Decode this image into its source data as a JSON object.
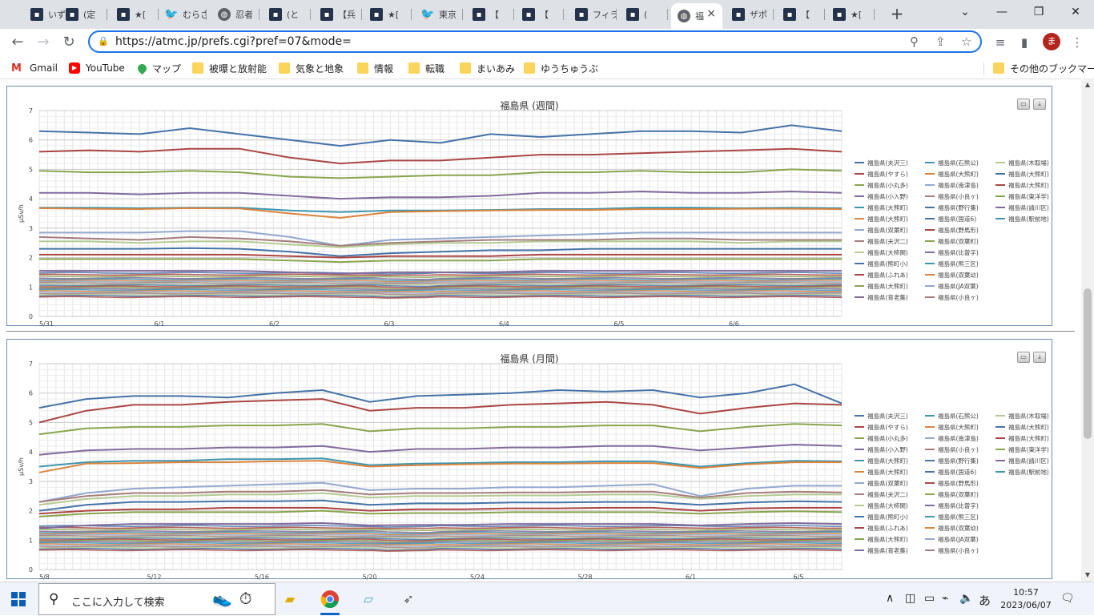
{
  "browser": {
    "tabs": [
      {
        "title": "いず",
        "icon": "site-favicon",
        "kind": "site"
      },
      {
        "title": "(定",
        "icon": "site-favicon",
        "kind": "site"
      },
      {
        "title": "★[",
        "icon": "site-favicon",
        "kind": "site"
      },
      {
        "title": "むらさ",
        "icon": "twitter-icon",
        "kind": "tw"
      },
      {
        "title": "忍者",
        "icon": "globe-icon",
        "kind": "globe"
      },
      {
        "title": "(と",
        "icon": "site-favicon",
        "kind": "site"
      },
      {
        "title": "【兵",
        "icon": "site-favicon",
        "kind": "site"
      },
      {
        "title": "★[",
        "icon": "site-favicon",
        "kind": "site"
      },
      {
        "title": "東京",
        "icon": "twitter-icon",
        "kind": "tw"
      },
      {
        "title": "【 ",
        "icon": "site-favicon",
        "kind": "site"
      },
      {
        "title": "【 ",
        "icon": "site-favicon",
        "kind": "site"
      },
      {
        "title": "フィラ",
        "icon": "site-favicon",
        "kind": "site"
      },
      {
        "title": "(",
        "icon": "site-favicon",
        "kind": "site"
      },
      {
        "title": "福",
        "icon": "globe-icon",
        "kind": "globe",
        "active": true
      },
      {
        "title": "ザポ",
        "icon": "site-favicon",
        "kind": "site"
      },
      {
        "title": "【 ",
        "icon": "site-favicon",
        "kind": "site"
      },
      {
        "title": "★[",
        "icon": "site-favicon",
        "kind": "site"
      }
    ],
    "new_tab": "+",
    "url": "https://atmc.jp/prefs.cgi?pref=07&mode=",
    "avatar_letter": "ま"
  },
  "bookmarks": [
    {
      "label": "Gmail",
      "icon": "gmail-icon"
    },
    {
      "label": "YouTube",
      "icon": "youtube-icon"
    },
    {
      "label": "マップ",
      "icon": "maps-icon"
    },
    {
      "label": "被曝と放射能",
      "icon": "folder-icon"
    },
    {
      "label": "気象と地象",
      "icon": "folder-icon"
    },
    {
      "label": "情報",
      "icon": "folder-icon"
    },
    {
      "label": "転職",
      "icon": "folder-icon"
    },
    {
      "label": "まいあみ",
      "icon": "folder-icon"
    },
    {
      "label": "ゆうちゅうぶ",
      "icon": "folder-icon"
    }
  ],
  "other_bookmarks": "その他のブックマーク",
  "chart_data": [
    {
      "type": "line",
      "title": "福島県 (週間)",
      "ylabel": "μSv/h",
      "ylim": [
        0,
        7
      ],
      "yticks": [
        "0",
        "1",
        "2",
        "3",
        "4",
        "5",
        "6",
        "7"
      ],
      "x_tick_labels": [
        "5/31",
        "6/1",
        "6/2",
        "6/3",
        "6/4",
        "6/5",
        "6/6"
      ],
      "grid": true,
      "legend_position": "right",
      "series": [
        {
          "name": "福島県(夫沢三)",
          "values": [
            6.3,
            6.25,
            6.2,
            6.4,
            6.2,
            6.0,
            5.8,
            6.0,
            5.9,
            6.2,
            6.1,
            6.2,
            6.3,
            6.3,
            6.25,
            6.5,
            6.3
          ],
          "color": "#4572a7"
        },
        {
          "name": "福島県(やすら)",
          "values": [
            5.6,
            5.65,
            5.6,
            5.7,
            5.7,
            5.4,
            5.2,
            5.3,
            5.3,
            5.4,
            5.5,
            5.5,
            5.55,
            5.6,
            5.65,
            5.7,
            5.6
          ],
          "color": "#aa4643"
        },
        {
          "name": "福島県(小丸多)",
          "values": [
            4.95,
            4.9,
            4.9,
            4.95,
            4.9,
            4.75,
            4.7,
            4.75,
            4.8,
            4.8,
            4.9,
            4.9,
            4.95,
            4.9,
            4.9,
            5.0,
            4.95
          ],
          "color": "#89a54e"
        },
        {
          "name": "福島県(小入野)",
          "values": [
            4.2,
            4.2,
            4.15,
            4.2,
            4.2,
            4.1,
            4.0,
            4.05,
            4.05,
            4.1,
            4.2,
            4.2,
            4.25,
            4.2,
            4.2,
            4.25,
            4.2
          ],
          "color": "#80699b"
        },
        {
          "name": "福島県(大熊町)",
          "values": [
            3.7,
            3.7,
            3.68,
            3.7,
            3.7,
            3.6,
            3.55,
            3.6,
            3.6,
            3.62,
            3.65,
            3.65,
            3.7,
            3.7,
            3.68,
            3.7,
            3.68
          ],
          "color": "#3d96ae"
        },
        {
          "name": "福島県(大熊町)",
          "values": [
            3.68,
            3.66,
            3.65,
            3.68,
            3.67,
            3.5,
            3.35,
            3.55,
            3.58,
            3.6,
            3.62,
            3.62,
            3.65,
            3.65,
            3.66,
            3.66,
            3.65
          ],
          "color": "#db843d"
        },
        {
          "name": "福島県(双葉町)",
          "values": [
            2.85,
            2.85,
            2.85,
            2.9,
            2.9,
            2.7,
            2.4,
            2.6,
            2.65,
            2.7,
            2.75,
            2.8,
            2.85,
            2.85,
            2.85,
            2.85,
            2.85
          ],
          "color": "#92a8cd"
        },
        {
          "name": "福島県(夫沢二)",
          "values": [
            2.7,
            2.65,
            2.6,
            2.7,
            2.65,
            2.55,
            2.4,
            2.5,
            2.55,
            2.6,
            2.6,
            2.6,
            2.65,
            2.65,
            2.6,
            2.6,
            2.6
          ],
          "color": "#a47d7c"
        },
        {
          "name": "福島県(大柿関)",
          "values": [
            2.55,
            2.55,
            2.5,
            2.55,
            2.55,
            2.45,
            2.35,
            2.45,
            2.5,
            2.5,
            2.55,
            2.55,
            2.55,
            2.55,
            2.5,
            2.55,
            2.55
          ],
          "color": "#b5ca92"
        },
        {
          "name": "福島県(熊町小)",
          "values": [
            2.3,
            2.3,
            2.3,
            2.32,
            2.3,
            2.2,
            2.05,
            2.15,
            2.2,
            2.25,
            2.25,
            2.3,
            2.3,
            2.3,
            2.3,
            2.3,
            2.3
          ],
          "color": "#4572a7"
        },
        {
          "name": "福島県(ふれあ)",
          "values": [
            2.1,
            2.1,
            2.1,
            2.1,
            2.1,
            2.05,
            2.0,
            2.05,
            2.05,
            2.05,
            2.1,
            2.1,
            2.1,
            2.1,
            2.1,
            2.1,
            2.1
          ],
          "color": "#aa4643"
        },
        {
          "name": "福島県(大熊町)",
          "values": [
            1.95,
            1.95,
            1.95,
            1.95,
            1.95,
            1.9,
            1.85,
            1.9,
            1.9,
            1.9,
            1.95,
            1.95,
            1.95,
            1.95,
            1.95,
            1.95,
            1.95
          ],
          "color": "#89a54e"
        },
        {
          "name": "福島県(育老集)",
          "values": [
            1.55,
            1.55,
            1.55,
            1.55,
            1.55,
            1.5,
            1.45,
            1.5,
            1.5,
            1.5,
            1.55,
            1.55,
            1.55,
            1.55,
            1.55,
            1.55,
            1.55
          ],
          "color": "#80699b"
        }
      ],
      "legend": [
        "福島県(夫沢三)",
        "福島県(石熊公)",
        "福島県(木取場)",
        "福島県(やすら)",
        "福島県(大熊町)",
        "福島県(大熊町)",
        "福島県(小丸多)",
        "福島県(南津島)",
        "福島県(大熊町)",
        "福島県(小入野)",
        "福島県(小良ヶ)",
        "福島県(東洋学)",
        "福島県(大熊町)",
        "福島県(野行集)",
        "福島県(請川区)",
        "福島県(大熊町)",
        "福島県(国道6)",
        "福島県(駅前地)",
        "福島県(双葉町)",
        "福島県(野馬形)",
        "",
        "福島県(夫沢二)",
        "福島県(双葉町)",
        "",
        "福島県(大柿関)",
        "福島県(比曽字)",
        "",
        "福島県(熊町小)",
        "福島県(熊三区)",
        "",
        "福島県(ふれあ)",
        "福島県(双葉幼)",
        "",
        "福島県(大熊町)",
        "福島県(JA双葉)",
        "",
        "福島県(育老集)",
        "福島県(小良ヶ)",
        ""
      ]
    },
    {
      "type": "line",
      "title": "福島県 (月間)",
      "ylabel": "μSv/h",
      "ylim": [
        0,
        7
      ],
      "yticks": [
        "0",
        "1",
        "2",
        "3",
        "4",
        "5",
        "6",
        "7"
      ],
      "x_tick_labels": [
        "5/8",
        "5/12",
        "5/16",
        "5/20",
        "5/24",
        "5/28",
        "6/1",
        "6/5"
      ],
      "grid": true,
      "legend_position": "right",
      "series": [
        {
          "name": "福島県(夫沢三)",
          "values": [
            5.5,
            5.8,
            5.9,
            5.9,
            5.85,
            6.0,
            6.1,
            5.7,
            5.9,
            5.95,
            6.0,
            6.1,
            6.05,
            6.1,
            5.85,
            6.0,
            6.3,
            5.65
          ],
          "color": "#4572a7"
        },
        {
          "name": "福島県(やすら)",
          "values": [
            5.0,
            5.4,
            5.6,
            5.6,
            5.7,
            5.75,
            5.8,
            5.4,
            5.5,
            5.5,
            5.6,
            5.65,
            5.7,
            5.6,
            5.3,
            5.5,
            5.65,
            5.6
          ],
          "color": "#aa4643"
        },
        {
          "name": "福島県(小丸多)",
          "values": [
            4.6,
            4.8,
            4.85,
            4.85,
            4.9,
            4.9,
            4.95,
            4.7,
            4.8,
            4.8,
            4.85,
            4.85,
            4.9,
            4.9,
            4.7,
            4.85,
            4.95,
            4.9
          ],
          "color": "#89a54e"
        },
        {
          "name": "福島県(小入野)",
          "values": [
            3.9,
            4.05,
            4.1,
            4.1,
            4.15,
            4.15,
            4.2,
            4.0,
            4.1,
            4.1,
            4.15,
            4.15,
            4.2,
            4.2,
            4.05,
            4.15,
            4.25,
            4.2
          ],
          "color": "#80699b"
        },
        {
          "name": "福島県(大熊町)",
          "values": [
            3.5,
            3.65,
            3.7,
            3.7,
            3.75,
            3.75,
            3.78,
            3.55,
            3.6,
            3.62,
            3.65,
            3.65,
            3.68,
            3.68,
            3.5,
            3.62,
            3.7,
            3.68
          ],
          "color": "#3d96ae"
        },
        {
          "name": "福島県(大熊町)",
          "values": [
            3.3,
            3.6,
            3.62,
            3.65,
            3.65,
            3.68,
            3.7,
            3.5,
            3.55,
            3.58,
            3.6,
            3.6,
            3.62,
            3.62,
            3.45,
            3.58,
            3.65,
            3.65
          ],
          "color": "#db843d"
        },
        {
          "name": "福島県(双葉町)",
          "values": [
            2.3,
            2.6,
            2.75,
            2.8,
            2.85,
            2.9,
            2.95,
            2.7,
            2.75,
            2.75,
            2.8,
            2.8,
            2.85,
            2.9,
            2.5,
            2.75,
            2.85,
            2.85
          ],
          "color": "#92a8cd"
        },
        {
          "name": "福島県(夫沢二)",
          "values": [
            2.3,
            2.5,
            2.6,
            2.6,
            2.65,
            2.65,
            2.7,
            2.55,
            2.6,
            2.6,
            2.62,
            2.62,
            2.65,
            2.65,
            2.45,
            2.6,
            2.65,
            2.62
          ],
          "color": "#a47d7c"
        },
        {
          "name": "福島県(大柿関)",
          "values": [
            2.2,
            2.4,
            2.5,
            2.5,
            2.55,
            2.55,
            2.6,
            2.45,
            2.5,
            2.5,
            2.52,
            2.52,
            2.55,
            2.55,
            2.4,
            2.5,
            2.55,
            2.55
          ],
          "color": "#b5ca92"
        },
        {
          "name": "福島県(熊町小)",
          "values": [
            2.0,
            2.2,
            2.3,
            2.3,
            2.32,
            2.32,
            2.35,
            2.2,
            2.25,
            2.25,
            2.28,
            2.28,
            2.3,
            2.3,
            2.2,
            2.28,
            2.32,
            2.3
          ],
          "color": "#4572a7"
        },
        {
          "name": "福島県(ふれあ)",
          "values": [
            1.9,
            2.0,
            2.05,
            2.05,
            2.1,
            2.1,
            2.1,
            2.0,
            2.05,
            2.05,
            2.08,
            2.08,
            2.1,
            2.1,
            2.0,
            2.08,
            2.1,
            2.1
          ],
          "color": "#aa4643"
        },
        {
          "name": "福島県(大熊町)",
          "values": [
            1.8,
            1.9,
            1.95,
            1.95,
            1.95,
            1.95,
            2.0,
            1.9,
            1.92,
            1.92,
            1.95,
            1.95,
            1.95,
            1.95,
            1.9,
            1.95,
            1.98,
            1.95
          ],
          "color": "#89a54e"
        },
        {
          "name": "福島県(育老集)",
          "values": [
            1.4,
            1.5,
            1.55,
            1.55,
            1.55,
            1.55,
            1.58,
            1.5,
            1.52,
            1.52,
            1.55,
            1.55,
            1.55,
            1.55,
            1.5,
            1.55,
            1.58,
            1.55
          ],
          "color": "#80699b"
        }
      ],
      "legend": [
        "福島県(夫沢三)",
        "福島県(石熊公)",
        "福島県(木取場)",
        "福島県(やすら)",
        "福島県(大熊町)",
        "福島県(大熊町)",
        "福島県(小丸多)",
        "福島県(南津島)",
        "福島県(大熊町)",
        "福島県(小入野)",
        "福島県(小良ヶ)",
        "福島県(東洋学)",
        "福島県(大熊町)",
        "福島県(野行集)",
        "福島県(請川区)",
        "福島県(大熊町)",
        "福島県(国道6)",
        "福島県(駅前地)",
        "福島県(双葉町)",
        "福島県(野馬形)",
        "",
        "福島県(夫沢二)",
        "福島県(双葉町)",
        "",
        "福島県(大柿関)",
        "福島県(比曽字)",
        "",
        "福島県(熊町小)",
        "福島県(熊三区)",
        "",
        "福島県(ふれあ)",
        "福島県(双葉幼)",
        "",
        "福島県(大熊町)",
        "福島県(JA双葉)",
        "",
        "福島県(育老集)",
        "福島県(小良ヶ)",
        ""
      ]
    }
  ],
  "legend_colors": [
    "#4572a7",
    "#3d96ae",
    "#b5ca92",
    "#aa4643",
    "#db843d",
    "#4572a7",
    "#89a54e",
    "#92a8cd",
    "#aa4643",
    "#80699b",
    "#a47d7c",
    "#89a54e",
    "#3d96ae",
    "#4572a7",
    "#80699b",
    "#db843d",
    "#4572a7",
    "#3d96ae",
    "#92a8cd",
    "#aa4643",
    "",
    "#a47d7c",
    "#89a54e",
    "",
    "#b5ca92",
    "#80699b",
    "",
    "#4572a7",
    "#3d96ae",
    "",
    "#aa4643",
    "#db843d",
    "",
    "#89a54e",
    "#92a8cd",
    "",
    "#80699b",
    "#a47d7c",
    ""
  ],
  "taskbar": {
    "search_placeholder": "ここに入力して検索",
    "ime_label": "あ",
    "time": "10:57",
    "date": "2023/06/07"
  }
}
